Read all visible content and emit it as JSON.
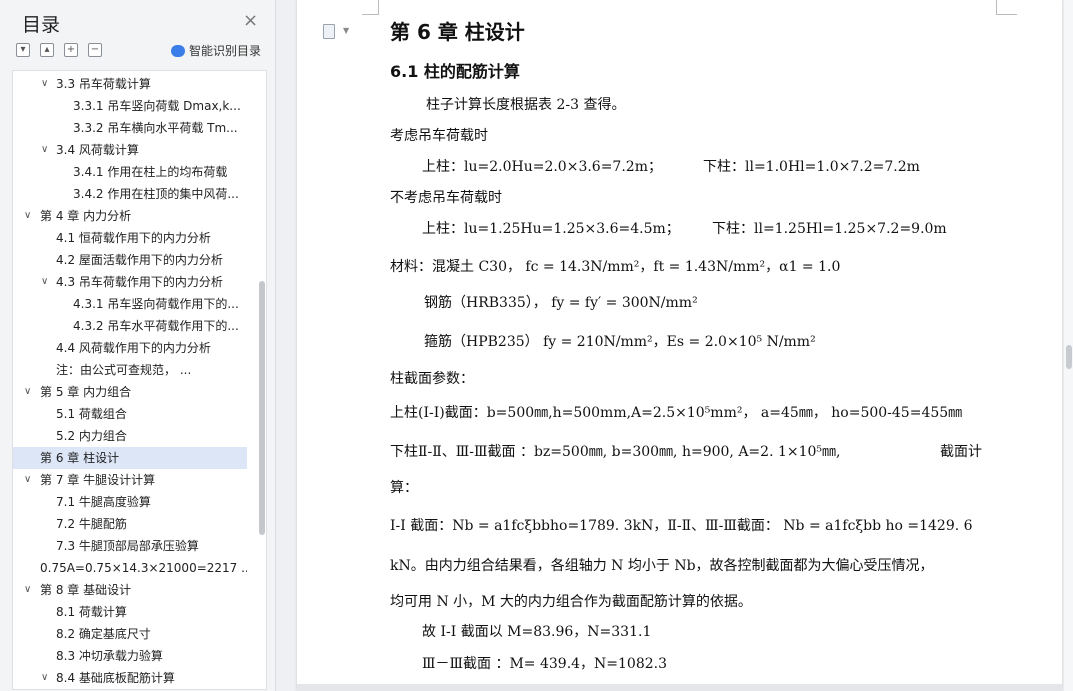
{
  "sidebar": {
    "title": "目录",
    "close_icon": "×",
    "tools": [
      "▾",
      "▴",
      "+",
      "−"
    ],
    "smart_label": "智能识别目录",
    "items": [
      {
        "level": 2,
        "chev": "∨",
        "text": "3.3  吊车荷载计算"
      },
      {
        "level": 3,
        "chev": "",
        "text": "3.3.1  吊车竖向荷载 Dmax,k..."
      },
      {
        "level": 3,
        "chev": "",
        "text": "3.3.2  吊车横向水平荷载 Tm..."
      },
      {
        "level": 2,
        "chev": "∨",
        "text": "3.4   风荷载计算"
      },
      {
        "level": 3,
        "chev": "",
        "text": "3.4.1  作用在柱上的均布荷载"
      },
      {
        "level": 3,
        "chev": "",
        "text": "3.4.2  作用在柱顶的集中风荷..."
      },
      {
        "level": 1,
        "chev": "∨",
        "text": "第 4 章   内力分析"
      },
      {
        "level": 2,
        "chev": "",
        "text": "4.1  恒荷载作用下的内力分析"
      },
      {
        "level": 2,
        "chev": "",
        "text": "4.2  屋面活载作用下的内力分析"
      },
      {
        "level": 2,
        "chev": "∨",
        "text": "4.3  吊车荷载作用下的内力分析"
      },
      {
        "level": 3,
        "chev": "",
        "text": "4.3.1  吊车竖向荷载作用下的..."
      },
      {
        "level": 3,
        "chev": "",
        "text": "4.3.2  吊车水平荷载作用下的..."
      },
      {
        "level": 2,
        "chev": "",
        "text": "4.4  风荷载作用下的内力分析"
      },
      {
        "level": 2,
        "chev": "",
        "text": "注：由公式可查规范，          ..."
      },
      {
        "level": 1,
        "chev": "∨",
        "text": "第 5 章   内力组合"
      },
      {
        "level": 2,
        "chev": "",
        "text": "5.1  荷载组合"
      },
      {
        "level": 2,
        "chev": "",
        "text": "5.2  内力组合"
      },
      {
        "level": 1,
        "chev": "",
        "text": "第 6 章   柱设计",
        "selected": true
      },
      {
        "level": 1,
        "chev": "∨",
        "text": "第 7 章   牛腿设计计算"
      },
      {
        "level": 2,
        "chev": "",
        "text": "7.1  牛腿高度验算"
      },
      {
        "level": 2,
        "chev": "",
        "text": "7.2  牛腿配筋"
      },
      {
        "level": 2,
        "chev": "",
        "text": "7.3  牛腿顶部局部承压验算"
      },
      {
        "level": 0,
        "chev": "",
        "text": "0.75A=0.75×14.3×21000=2217  ..."
      },
      {
        "level": 1,
        "chev": "∨",
        "text": "第 8 章   基础设计"
      },
      {
        "level": 2,
        "chev": "",
        "text": "8.1  荷载计算"
      },
      {
        "level": 2,
        "chev": "",
        "text": "8.2  确定基底尺寸"
      },
      {
        "level": 2,
        "chev": "",
        "text": "8.3  冲切承载力验算"
      },
      {
        "level": 2,
        "chev": "∨",
        "text": "8.4  基础底板配筋计算"
      }
    ]
  },
  "document": {
    "chapter_title": "第 6 章    柱设计",
    "section_title": "6.1  柱的配筋计算",
    "lines": [
      "柱子计算长度根据表 2-3 查得。",
      "考虑吊车荷载时",
      "上柱：lu=2.0Hu=2.0×3.6=7.2m；",
      "下柱：ll=1.0Hl=1.0×7.2=7.2m",
      "不考虑吊车荷载时",
      "上柱：lu=1.25Hu=1.25×3.6=4.5m；",
      "下柱：ll=1.25Hl=1.25×7.2=9.0m",
      "材料：混凝土 C30，  fc = 14.3N/mm²，ft = 1.43N/mm²，α1 = 1.0",
      "钢筋（HRB335），  fy = fy′ = 300N/mm²",
      "箍筋（HPB235） fy = 210N/mm²，Es = 2.0×10⁵ N/mm²",
      "柱截面参数：",
      "上柱(I-I)截面：b=500㎜,h=500mm,A=2.5×10⁵mm²， a=45㎜，  ho=500-45=455㎜",
      "下柱Ⅱ-Ⅱ、Ⅲ-Ⅲ截面 ：bz=500㎜, b=300㎜, h=900, A=2. 1×10⁵㎜,",
      "截面计",
      "算：",
      "I-I 截面：Nb = a1fcξbbho=1789. 3kN，Ⅱ-Ⅱ、Ⅲ-Ⅲ截面：  Nb = a1fcξbb  ho   =1429. 6",
      "kN。由内力组合结果看，各组轴力 N 均小于 Nb，故各控制截面都为大偏心受压情况，",
      "均可用 N 小，M 大的内力组合作为截面配筋计算的依据。",
      "故 I-I 截面以 M=83.96，N=331.1",
      "Ⅲ－Ⅲ截面  ：M= 439.4，N=1082.3"
    ]
  }
}
